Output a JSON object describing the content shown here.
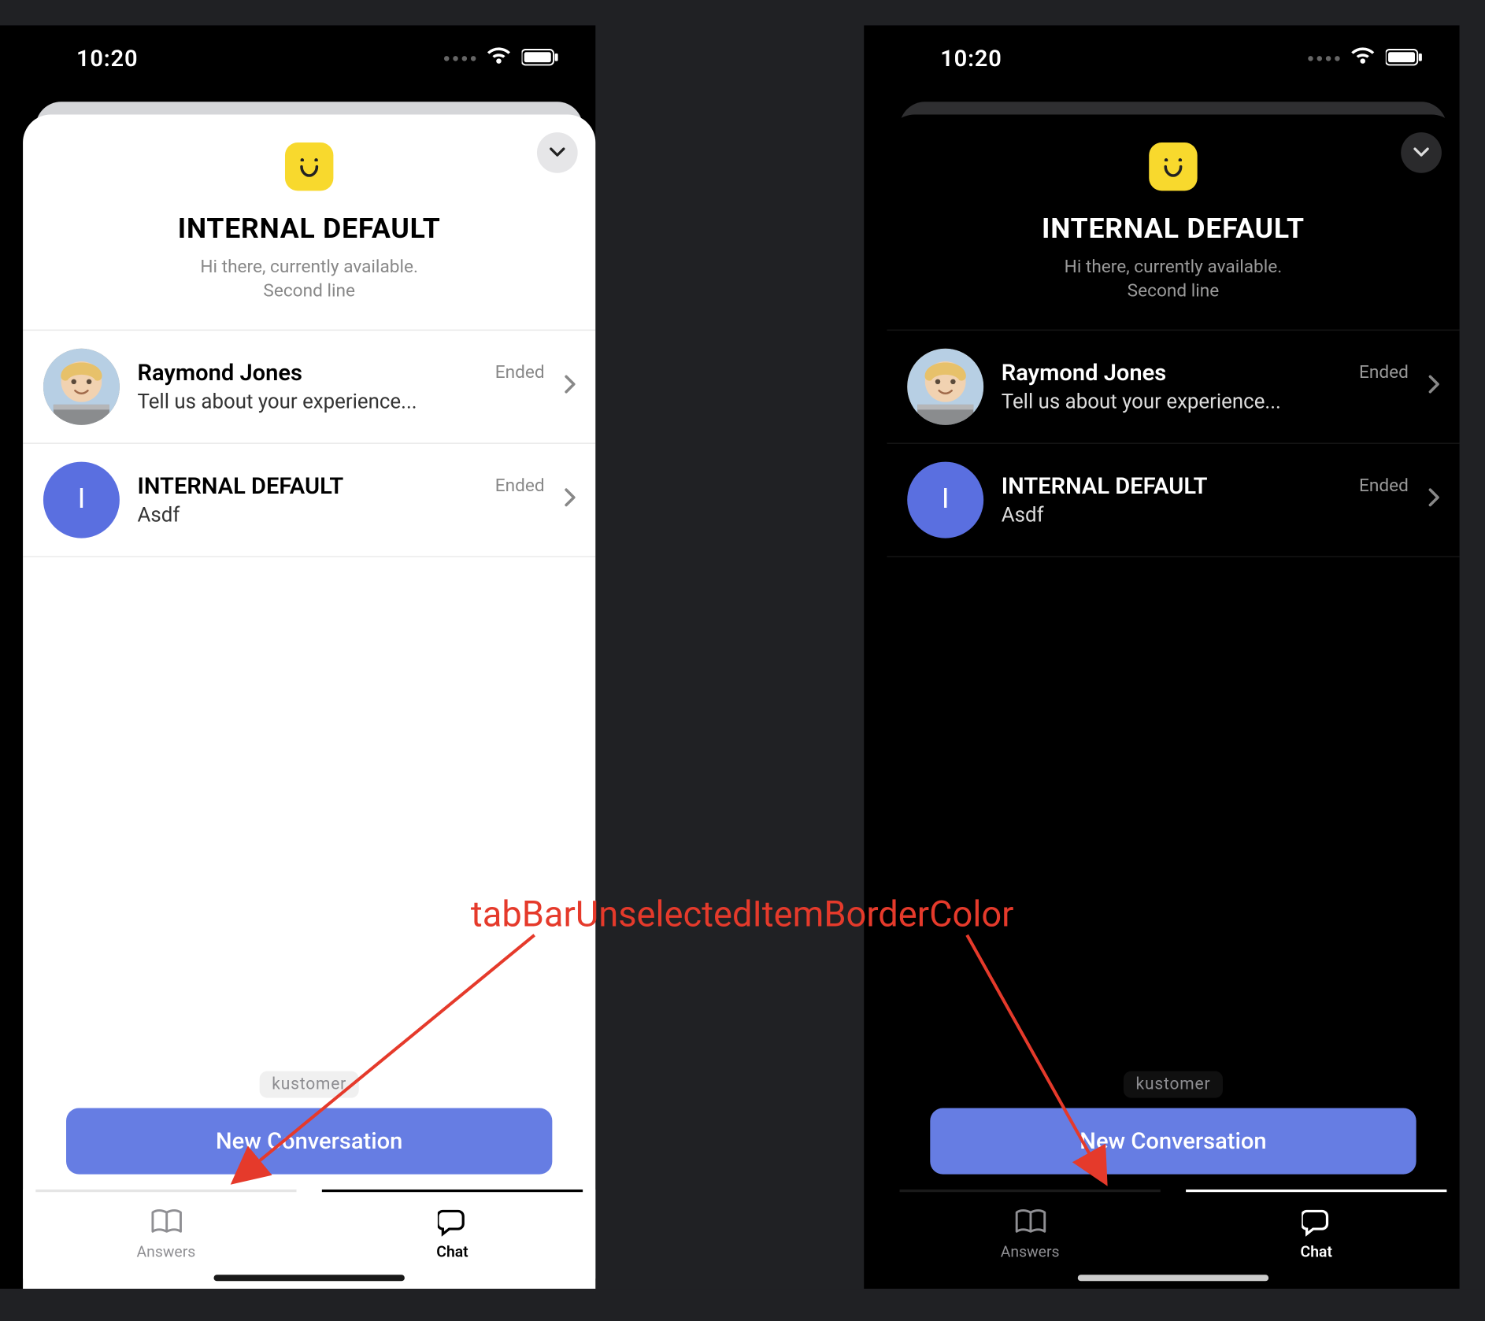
{
  "annotation": {
    "label": "tabBarUnselectedItemBorderColor"
  },
  "statusbar": {
    "time": "10:20"
  },
  "sheet": {
    "title": "INTERNAL DEFAULT",
    "subtitle_line1": "Hi there, currently available.",
    "subtitle_line2": "Second line"
  },
  "conversations": [
    {
      "name": "Raymond Jones",
      "preview": "Tell us about your experience...",
      "status": "Ended",
      "avatar": {
        "type": "photo"
      }
    },
    {
      "name": "INTERNAL DEFAULT",
      "preview": "Asdf",
      "status": "Ended",
      "avatar": {
        "type": "letter",
        "letter": "I",
        "bg": "#5a6fe0"
      }
    }
  ],
  "footer": {
    "powered_by": "kustomer",
    "new_button": "New Conversation"
  },
  "tabs": {
    "answers": "Answers",
    "chat": "Chat"
  },
  "colors": {
    "accent": "#667de3",
    "annotation": "#e53a2b",
    "brand_logo_bg": "#f8d92d"
  }
}
